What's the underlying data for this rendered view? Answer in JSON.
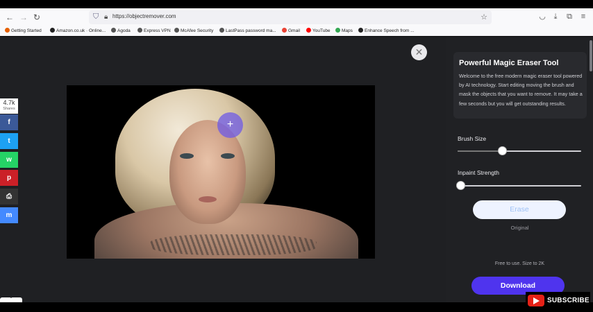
{
  "browser": {
    "url": "https://objectremover.com",
    "bookmarks": [
      {
        "label": "Getting Started",
        "color": "#e66000"
      },
      {
        "label": "Amazon.co.uk · Online...",
        "color": "#222222"
      },
      {
        "label": "Agoda",
        "color": "#555555"
      },
      {
        "label": "Express VPN",
        "color": "#555555"
      },
      {
        "label": "McAfee Security",
        "color": "#555555"
      },
      {
        "label": "LastPass password ma...",
        "color": "#555555"
      },
      {
        "label": "Gmail",
        "color": "#ea4335"
      },
      {
        "label": "YouTube",
        "color": "#ff0000"
      },
      {
        "label": "Maps",
        "color": "#34a853"
      },
      {
        "label": "Enhance Speech from ...",
        "color": "#222222"
      }
    ]
  },
  "share": {
    "count": "4.7k",
    "count_label": "Shares",
    "buttons": [
      {
        "name": "facebook",
        "glyph": "f",
        "color": "#3b5998"
      },
      {
        "name": "twitter",
        "glyph": "t",
        "color": "#1da1f2"
      },
      {
        "name": "whatsapp",
        "glyph": "w",
        "color": "#25d366"
      },
      {
        "name": "pinterest",
        "glyph": "p",
        "color": "#cb2027"
      },
      {
        "name": "print",
        "glyph": "⎙",
        "color": "#333333"
      },
      {
        "name": "messenger",
        "glyph": "m",
        "color": "#448aff"
      }
    ]
  },
  "panel": {
    "title": "Powerful Magic Eraser Tool",
    "description": "Welcome to the free modern magic eraser tool powered by AI technology. Start editing moving the brush and mask the objects that you want to remove. It may take a few seconds but you will get outstanding results.",
    "brush_size": {
      "label": "Brush Size",
      "value_fraction": 0.36
    },
    "inpaint_strength": {
      "label": "Inpaint Strength",
      "value_fraction": 0.02
    },
    "erase_label": "Erase",
    "original_label": "Original",
    "free_note": "Free to use. Size to 2K",
    "download_label": "Download"
  },
  "overlay": {
    "subscribe_label": "SUBSCRIBE"
  },
  "colors": {
    "accent": "#4f34ee",
    "brush": "#6e5ae6",
    "page_bg": "#202124"
  }
}
